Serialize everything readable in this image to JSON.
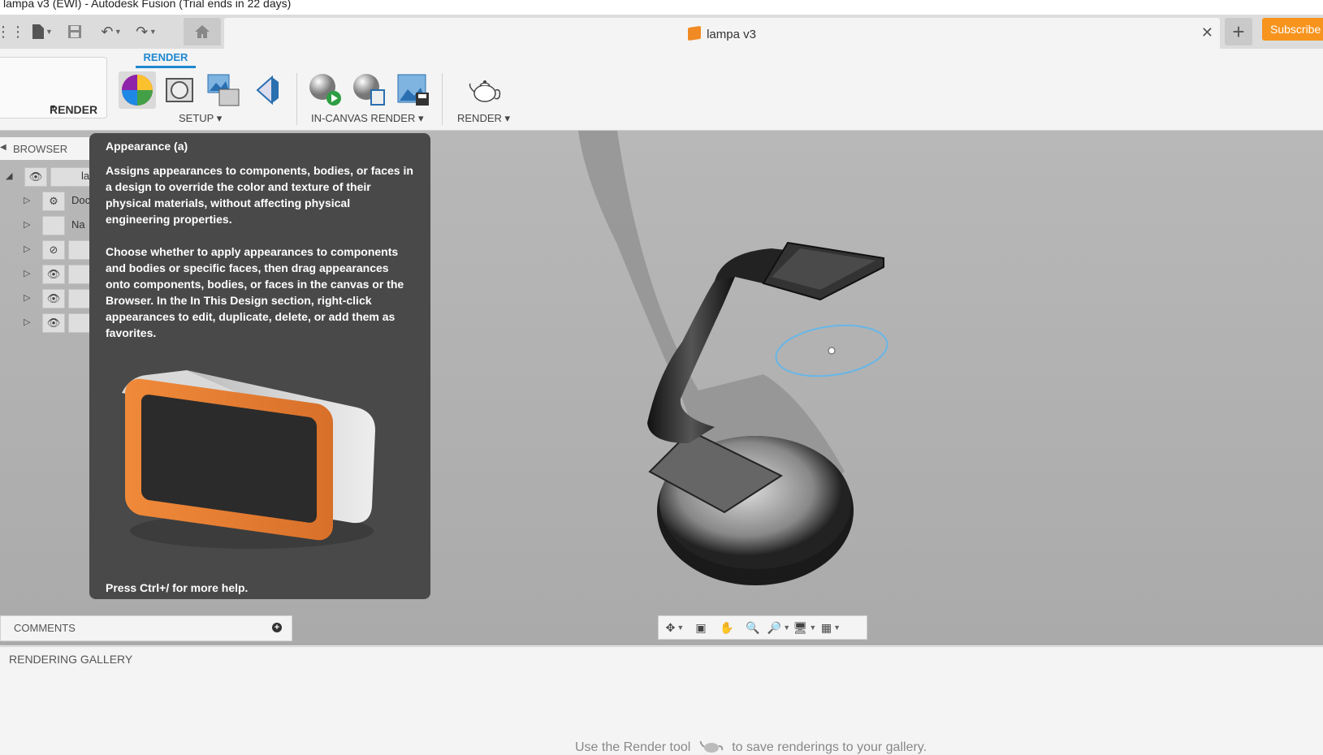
{
  "window": {
    "title": "lampa v3 (EWI) - Autodesk Fusion (Trial ends in 22 days)"
  },
  "tabs": {
    "document_title": "lampa v3",
    "subscribe_label": "Subscribe"
  },
  "toolbar": {
    "workspace_label": "RENDER",
    "active_tab": "RENDER",
    "groups": {
      "setup": "SETUP ▾",
      "in_canvas": "IN-CANVAS RENDER ▾",
      "render": "RENDER ▾"
    }
  },
  "browser": {
    "title": "BROWSER",
    "rows": [
      {
        "label": "la"
      },
      {
        "label": "Doc"
      },
      {
        "label": "Na"
      },
      {
        "label": ""
      },
      {
        "label": ""
      },
      {
        "label": ""
      },
      {
        "label": ""
      }
    ]
  },
  "tooltip": {
    "title": "Appearance (a)",
    "paragraph1": "Assigns appearances to components, bodies, or faces in a design to override the color and texture of their physical materials, without affecting physical engineering properties.",
    "paragraph2": "Choose whether to apply appearances to components and bodies or specific faces, then drag appearances onto components, bodies, or faces in the canvas or the Browser. In the In This Design section, right-click appearances to edit, duplicate, delete, or add them as favorites.",
    "help": "Press Ctrl+/ for more help."
  },
  "comments": {
    "label": "COMMENTS"
  },
  "gallery": {
    "title": "RENDERING GALLERY",
    "message_before": "Use the Render tool",
    "message_after": "to save renderings to your gallery."
  },
  "colors": {
    "accent": "#1e88d0",
    "subscribe": "#f7941e",
    "tooltip_bg": "#494949"
  }
}
